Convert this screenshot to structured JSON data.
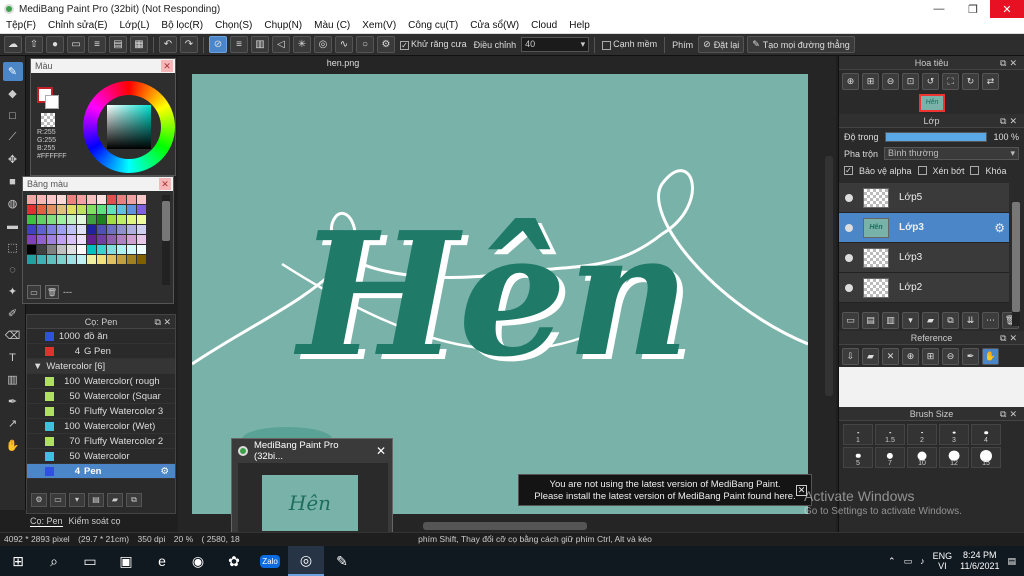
{
  "window": {
    "title": "MediBang Paint Pro (32bit) (Not Responding)",
    "minimize": "—",
    "maximize": "❐",
    "close": "✕"
  },
  "menu": [
    "Tệp(F)",
    "Chỉnh sửa(E)",
    "Lớp(L)",
    "Bộ lọc(R)",
    "Chọn(S)",
    "Chụp(N)",
    "Màu (C)",
    "Xem(V)",
    "Công cụ(T)",
    "Cửa sổ(W)",
    "Cloud",
    "Help"
  ],
  "toolbar": {
    "antialias_label": "Khử răng cưa",
    "adjust_label": "Điều chỉnh",
    "adjust_value": "40",
    "margin_label": "Cạnh mềm",
    "key_label": "Phím",
    "set_label": "Đặt lại",
    "straight_label": "Tạo mọi đường thẳng"
  },
  "color_panel": {
    "title": "Màu",
    "r": "R:255",
    "g": "G:255",
    "b": "B:255",
    "hex": "#FFFFFF"
  },
  "palette_panel": {
    "title": "Bảng màu",
    "colors": [
      "#f4a6a6",
      "#f7b7b7",
      "#f9c7c7",
      "#fcd9d9",
      "#f08080",
      "#f4a0a0",
      "#f7c0c0",
      "#ffe0e0",
      "#e05050",
      "#e88080",
      "#f0a0a0",
      "#f8c8c8",
      "#e03030",
      "#e06040",
      "#e09060",
      "#e0c080",
      "#e0e060",
      "#c0e060",
      "#80e060",
      "#60e080",
      "#60e0c0",
      "#60c0e0",
      "#6090e0",
      "#8060e0",
      "#40c040",
      "#60d060",
      "#80e080",
      "#a0f0a0",
      "#c0f0c0",
      "#e0f8e0",
      "#40a040",
      "#208020",
      "#a0e040",
      "#c0f060",
      "#e0f880",
      "#f0fca0",
      "#4040c0",
      "#6060d0",
      "#8080e0",
      "#a0a0f0",
      "#c0c0f8",
      "#e0e0fc",
      "#2020a0",
      "#5050b0",
      "#7070c0",
      "#9090d0",
      "#b0b0e0",
      "#d0d0f0",
      "#8040c0",
      "#9060d0",
      "#a080e0",
      "#c0a0f0",
      "#d8c0f8",
      "#ece0fc",
      "#602090",
      "#7040a0",
      "#9060b0",
      "#b080c0",
      "#d0a0d0",
      "#e8c8e8",
      "#000000",
      "#404040",
      "#808080",
      "#c0c0c0",
      "#e0e0e0",
      "#ffffff",
      "#00c0c0",
      "#40d0d0",
      "#80e0e0",
      "#b0f0f0",
      "#d0f8f8",
      "#f0ffff",
      "#20a0a0",
      "#40b0b0",
      "#60c0c0",
      "#80d0d0",
      "#a0e0e0",
      "#c0f0f0",
      "#f0f0a0",
      "#f0e080",
      "#e0c060",
      "#c0a040",
      "#a08020",
      "#806000"
    ],
    "more": "---"
  },
  "brush_panel": {
    "title": "Cọ: Pen",
    "items": [
      {
        "size": "1000",
        "name": "đồ ăn",
        "color": "#3050e0",
        "kind": "item"
      },
      {
        "size": "4",
        "name": "G Pen",
        "color": "#e03030",
        "kind": "item"
      },
      {
        "size": "",
        "name": "Watercolor [6]",
        "color": "",
        "kind": "group"
      },
      {
        "size": "100",
        "name": "Watercolor( rough",
        "color": "#b0e060",
        "kind": "item"
      },
      {
        "size": "50",
        "name": "Watercolor (Squar",
        "color": "#b0e060",
        "kind": "item"
      },
      {
        "size": "50",
        "name": "Fluffy Watercolor 3",
        "color": "#b0e060",
        "kind": "item"
      },
      {
        "size": "100",
        "name": "Watercolor (Wet)",
        "color": "#40c0e0",
        "kind": "item"
      },
      {
        "size": "70",
        "name": "Fluffy Watercolor 2",
        "color": "#b0e060",
        "kind": "item"
      },
      {
        "size": "50",
        "name": "Watercolor",
        "color": "#40c0e0",
        "kind": "item"
      },
      {
        "size": "4",
        "name": "Pen",
        "color": "#3050e0",
        "kind": "sel"
      }
    ],
    "tab_brush": "Cọ: Pen",
    "tab_control": "Kiểm soát cọ"
  },
  "canvas": {
    "tab": "hen.png",
    "artwork_text": "Hên",
    "bg_color": "#79b2a8"
  },
  "navigator": {
    "title": "Hoa tiêu",
    "thumb_text": "Hên"
  },
  "layer_panel": {
    "title": "Lớp",
    "opacity_label": "Độ trong",
    "opacity_value": "100 %",
    "opacity_fraction": 1.0,
    "blend_label": "Pha trộn",
    "blend_value": "Bình thường",
    "protect_alpha": "Bảo vệ alpha",
    "clipping": "Xén bớt",
    "lock": "Khóa",
    "layers": [
      {
        "name": "Lớp5",
        "selected": false,
        "thumb": ""
      },
      {
        "name": "Lớp3",
        "selected": true,
        "thumb": "Hên"
      },
      {
        "name": "Lớp3",
        "selected": false,
        "thumb": ""
      },
      {
        "name": "Lớp2",
        "selected": false,
        "thumb": ""
      }
    ]
  },
  "reference_panel": {
    "title": "Reference"
  },
  "brushsize_panel": {
    "title": "Brush Size",
    "sizes": [
      "1",
      "1.5",
      "2",
      "3",
      "4",
      "5",
      "7",
      "10",
      "12",
      "15"
    ]
  },
  "notification": {
    "line1": "You are not using the latest version of MediBang Paint.",
    "line2": "Please install the latest version of MediBang Paint found here.",
    "close": "✕"
  },
  "taskbar_preview": {
    "title": "MediBang Paint Pro (32bi...",
    "thumb_text": "Hên"
  },
  "watermark": {
    "line1": "Activate Windows",
    "line2": "Go to Settings to activate Windows."
  },
  "status": {
    "size": "4092 * 2893 pixel",
    "physical": "(29.7 * 21cm)",
    "dpi": "350 dpi",
    "zoom": "20 %",
    "coords": "( 2580, 18",
    "hint": "phím Shift, Thay đổi cỡ cọ bằng cách giữ phím Ctrl, Alt và kéo"
  },
  "taskbar": {
    "lang_top": "ENG",
    "lang_bottom": "VI",
    "time": "8:24 PM",
    "date": "11/6/2021",
    "zalo": "Zalo"
  }
}
